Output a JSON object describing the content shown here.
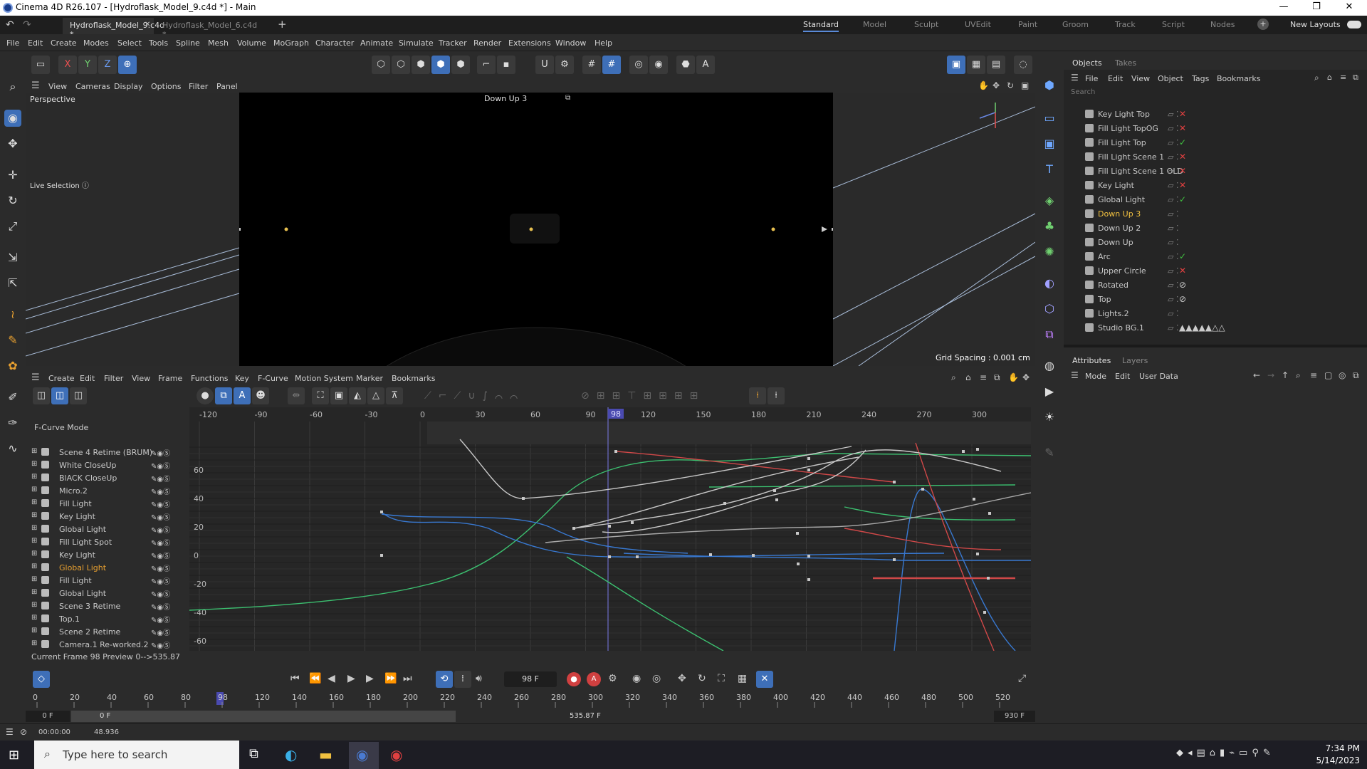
{
  "window": {
    "title": "Cinema 4D R26.107 - [Hydroflask_Model_9.c4d *] - Main"
  },
  "tabs": [
    {
      "label": "Hydroflask_Model_9.c4d *"
    },
    {
      "label": "Hydroflask_Model_6.c4d *"
    }
  ],
  "layouts": [
    "Standard",
    "Model",
    "Sculpt",
    "UVEdit",
    "Paint",
    "Groom",
    "Track",
    "Script",
    "Nodes"
  ],
  "new_layouts": "New Layouts",
  "menu": [
    "File",
    "Edit",
    "Create",
    "Modes",
    "Select",
    "Tools",
    "Spline",
    "Mesh",
    "Volume",
    "MoGraph",
    "Character",
    "Animate",
    "Simulate",
    "Tracker",
    "Render",
    "Extensions",
    "Window",
    "Help"
  ],
  "axes": {
    "x": "X",
    "y": "Y",
    "z": "Z"
  },
  "viewport": {
    "menu": [
      "View",
      "Cameras",
      "Display",
      "Options",
      "Filter",
      "Panel"
    ],
    "label": "Perspective",
    "camera": "Down Up 3",
    "tool": "Live Selection",
    "grid": "Grid Spacing : 0.001 cm"
  },
  "objects": {
    "tabs": [
      "Objects",
      "Takes"
    ],
    "menu": [
      "File",
      "Edit",
      "View",
      "Object",
      "Tags",
      "Bookmarks"
    ],
    "search": "Search",
    "rows": [
      {
        "name": "Key Light Top",
        "tag": "✕",
        "color": "#e04040"
      },
      {
        "name": "Fill Light TopOG",
        "tag": "✕",
        "color": "#e04040"
      },
      {
        "name": "Fill Light Top",
        "tag": "✓",
        "color": "#40c040"
      },
      {
        "name": "Fill Light Scene 1",
        "tag": "✕",
        "color": "#e04040"
      },
      {
        "name": "Fill Light Scene 1 OLD",
        "tag": "✕",
        "color": "#e04040"
      },
      {
        "name": "Key Light",
        "tag": "✕",
        "color": "#e04040"
      },
      {
        "name": "Global Light",
        "tag": "✓",
        "color": "#40c040"
      },
      {
        "name": "Down Up 3",
        "tag": "",
        "color": "#ccc"
      },
      {
        "name": "Down Up 2",
        "tag": "",
        "color": "#ccc"
      },
      {
        "name": "Down Up",
        "tag": "",
        "color": "#ccc"
      },
      {
        "name": "Arc",
        "tag": "✓",
        "color": "#40c040"
      },
      {
        "name": "Upper Circle",
        "tag": "✕",
        "color": "#e04040"
      },
      {
        "name": "Rotated",
        "tag": "⊘",
        "color": "#ccc"
      },
      {
        "name": "Top",
        "tag": "⊘",
        "color": "#ccc"
      },
      {
        "name": "Lights.2",
        "tag": "",
        "color": "#ccc"
      },
      {
        "name": "Studio BG.1",
        "tag": "▲▲▲▲▲△△",
        "color": "#ccc"
      }
    ]
  },
  "attributes": {
    "tabs": [
      "Attributes",
      "Layers"
    ],
    "menu": [
      "Mode",
      "Edit",
      "User Data"
    ]
  },
  "timeline": {
    "menu": [
      "Create",
      "Edit",
      "Filter",
      "View",
      "Frame",
      "Functions",
      "Key",
      "F-Curve",
      "Motion System",
      "Marker",
      "Bookmarks"
    ],
    "mode": "F-Curve Mode",
    "tracks": [
      "Scene 4 Retime (BRUM)",
      "White CloseUp",
      "BlACK CloseUp",
      "Micro.2",
      "Fill Light",
      "Key Light",
      "Global Light",
      "Fill Light Spot",
      "Key Light",
      "Global Light",
      "Fill Light",
      "Global Light",
      "Scene 3 Retime",
      "Top.1",
      "Scene 2 Retime",
      "Camera.1 Re-worked.2"
    ],
    "frame_ticks": [
      "-120",
      "-90",
      "-60",
      "-30",
      "0",
      "30",
      "60",
      "90",
      "120",
      "150",
      "180",
      "210",
      "240",
      "270",
      "300"
    ],
    "current_marker": "98",
    "value_ticks": [
      "60",
      "40",
      "20",
      "0",
      "-20",
      "-40",
      "-60"
    ],
    "status": "Current Frame  98  Preview  0-->535.87"
  },
  "transport": {
    "frame": "98 F"
  },
  "ruler": {
    "ticks": [
      "0",
      "20",
      "40",
      "60",
      "80",
      "98",
      "120",
      "140",
      "160",
      "180",
      "200",
      "220",
      "240",
      "260",
      "280",
      "300",
      "320",
      "340",
      "360",
      "380",
      "400",
      "420",
      "440",
      "460",
      "480",
      "500",
      "520"
    ]
  },
  "range": {
    "start": "0 F",
    "preview_start": "0 F",
    "preview_end": "535.87 F",
    "end": "930 F"
  },
  "bottom": {
    "time": "00:00:00",
    "value": "48.936"
  },
  "taskbar": {
    "search": "Type here to search",
    "time": "7:34 PM",
    "date": "5/14/2023"
  }
}
